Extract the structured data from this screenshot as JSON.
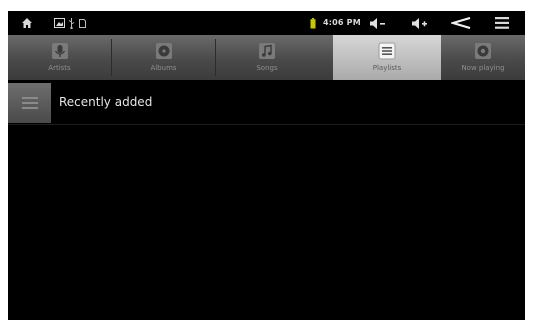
{
  "status_bar": {
    "icons": [
      "home-icon",
      "notification-image-icon",
      "usb-icon",
      "sd-card-icon",
      "battery-icon",
      "volume-down-icon",
      "volume-up-icon",
      "back-icon",
      "menu-icon"
    ],
    "time": "4:06 PM"
  },
  "tabs": [
    {
      "label": "Artists",
      "icon": "artists-icon",
      "selected": false
    },
    {
      "label": "Albums",
      "icon": "albums-icon",
      "selected": false
    },
    {
      "label": "Songs",
      "icon": "songs-icon",
      "selected": false
    },
    {
      "label": "Playlists",
      "icon": "playlists-icon",
      "selected": true
    },
    {
      "label": "Now playing",
      "icon": "now-playing-icon",
      "selected": false
    }
  ],
  "list": {
    "items": [
      {
        "label": "Recently added",
        "icon": "playlist-thumb-icon"
      }
    ]
  },
  "colors": {
    "background": "#000000",
    "tab_bar": "#4a4a4a",
    "tab_selected": "#c4c4c4",
    "battery": "#c8c800"
  }
}
